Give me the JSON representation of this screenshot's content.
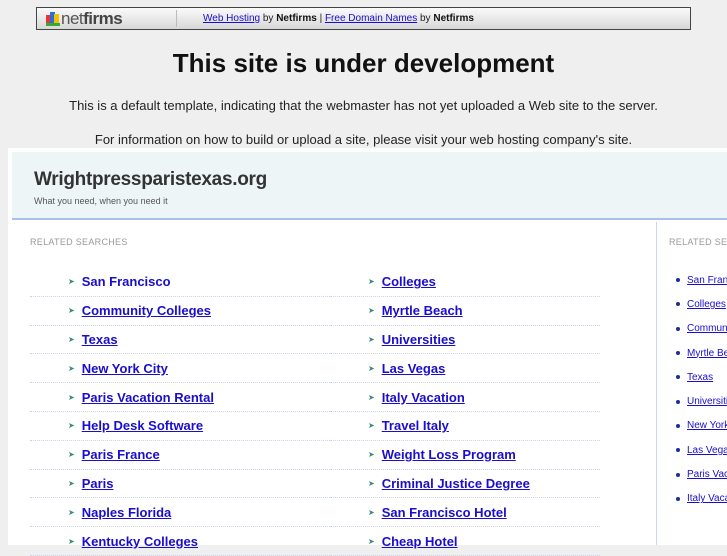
{
  "topbar": {
    "logo": "netfirms",
    "link1": "Web Hosting",
    "by1": "by",
    "brand1": "Netfirms",
    "sep": "|",
    "link2": "Free Domain Names",
    "by2": "by",
    "brand2": "Netfirms"
  },
  "notice": {
    "title": "This site is under development",
    "line1": "This is a default template, indicating that the webmaster has not yet uploaded a Web site to the server.",
    "line2": "For information on how to build or upload a site, please visit your web hosting company's site."
  },
  "site": {
    "name": "Wrightpressparistexas.org",
    "tagline": "What you need, when you need it"
  },
  "main": {
    "label": "RELATED SEARCHES",
    "col1": [
      "San Francisco",
      "Community Colleges",
      "Texas",
      "New York City",
      "Paris Vacation Rental",
      "Help Desk Software",
      "Paris France",
      "Paris",
      "Naples Florida",
      "Kentucky Colleges"
    ],
    "col2": [
      "Colleges",
      "Myrtle Beach",
      "Universities",
      "Las Vegas",
      "Italy Vacation",
      "Travel Italy",
      "Weight Loss Program",
      "Criminal Justice Degree",
      "San Francisco Hotel",
      "Cheap Hotel"
    ]
  },
  "side": {
    "label": "RELATED SEARCHES",
    "items": [
      "San Francisco",
      "Colleges",
      "Community Colleges",
      "Myrtle Beach",
      "Texas",
      "Universities",
      "New York City",
      "Las Vegas",
      "Paris Vacation Rental",
      "Italy Vacation"
    ]
  }
}
